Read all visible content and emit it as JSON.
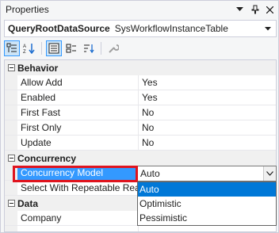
{
  "window": {
    "title": "Properties"
  },
  "object_selector": {
    "name": "QueryRootDataSource",
    "type": "SysWorkflowInstanceTable"
  },
  "toolbar": {
    "buttons": [
      "categorized-icon",
      "alphabetical-icon",
      "properties-icon",
      "events-icon",
      "property-pages-icon",
      "wrench-icon"
    ]
  },
  "grid": {
    "categories": [
      {
        "name": "Behavior",
        "rows": [
          {
            "name": "Allow Add",
            "value": "Yes"
          },
          {
            "name": "Enabled",
            "value": "Yes"
          },
          {
            "name": "First Fast",
            "value": "No"
          },
          {
            "name": "First Only",
            "value": "No"
          },
          {
            "name": "Update",
            "value": "No"
          }
        ]
      },
      {
        "name": "Concurrency",
        "rows": [
          {
            "name": "Concurrency Model",
            "value": "Auto"
          },
          {
            "name": "Select With Repeatable Read",
            "value": ""
          }
        ]
      },
      {
        "name": "Data",
        "rows": [
          {
            "name": "Company",
            "value": ""
          }
        ]
      }
    ]
  },
  "dropdown": {
    "selected": "Auto",
    "options": [
      "Auto",
      "Optimistic",
      "Pessimistic"
    ]
  },
  "colors": {
    "highlight_border": "#e0141e",
    "selection": "#3399ff",
    "list_selection": "#0078d7"
  }
}
